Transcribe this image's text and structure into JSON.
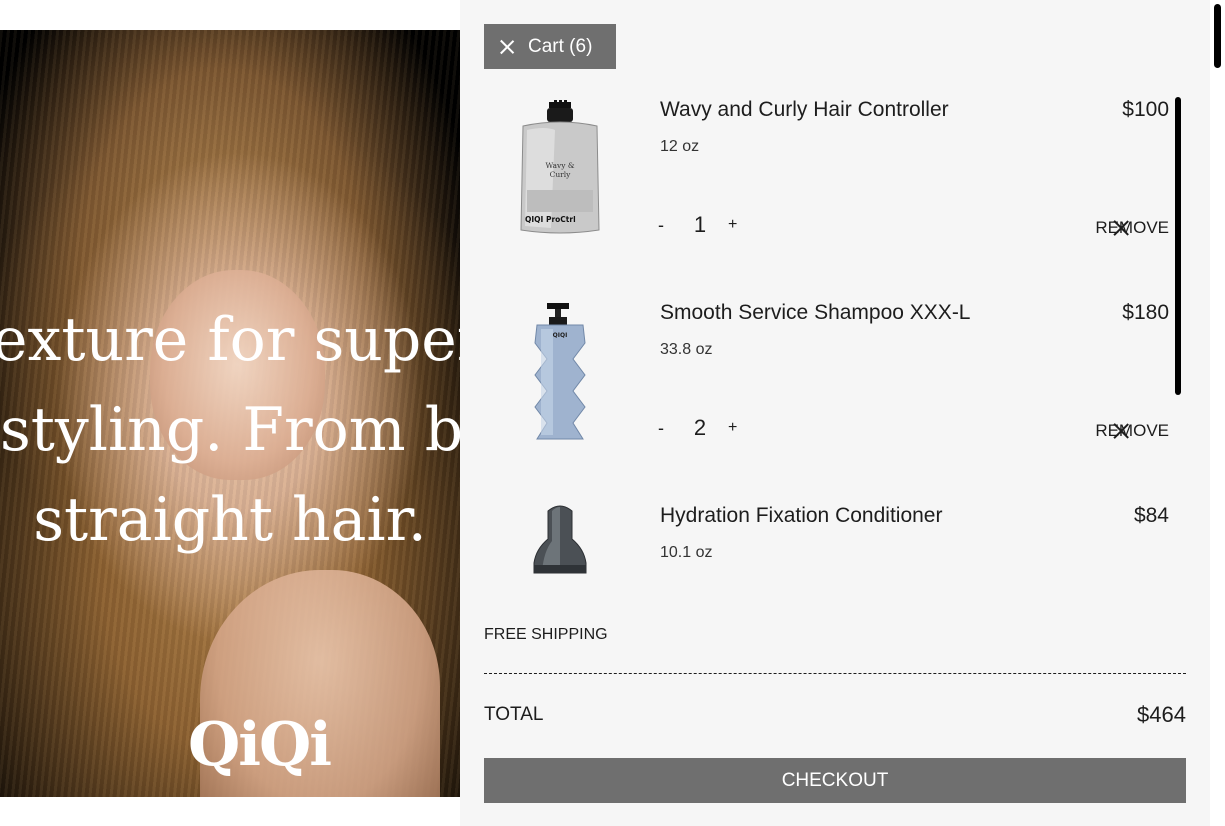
{
  "hero": {
    "text_lines": [
      "exture for superio",
      "styling. From bou",
      "straight hair."
    ],
    "logo": "QiQi"
  },
  "cart": {
    "close_label": "Cart (6)",
    "items": [
      {
        "name": "Wavy and Curly Hair Controller",
        "size": "12 oz",
        "price": "$100",
        "quantity": "1",
        "minus": "-",
        "plus": "+",
        "remove_label": "REMOVE",
        "product_label_lines": [
          "Wavy &",
          "Curly"
        ],
        "brand_mark": "QIQI ProCtrl",
        "image": "silver-pouch"
      },
      {
        "name": "Smooth Service Shampoo XXX-L",
        "size": "33.8 oz",
        "price": "$180",
        "quantity": "2",
        "minus": "-",
        "plus": "+",
        "remove_label": "REMOVE",
        "brand_mark": "QIQI",
        "image": "blue-pump-bottle"
      },
      {
        "name": "Hydration Fixation Conditioner",
        "size": "10.1 oz",
        "price": "$84",
        "image": "dark-dome-bottle"
      }
    ],
    "free_shipping": "FREE SHIPPING",
    "total_label": "TOTAL",
    "total_value": "$464",
    "checkout_label": "CHECKOUT"
  },
  "colors": {
    "drawer_bg": "#f6f6f6",
    "button_bg": "#6f6f6f",
    "text": "#1d1d1d"
  }
}
